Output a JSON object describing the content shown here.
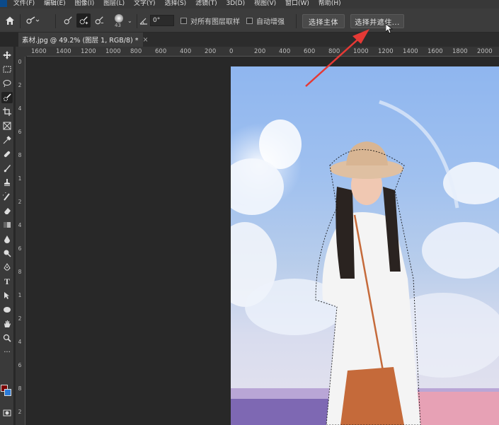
{
  "menubar": {
    "items": [
      "文件(F)",
      "编辑(E)",
      "图像(I)",
      "图层(L)",
      "文字(Y)",
      "选择(S)",
      "滤镜(T)",
      "3D(D)",
      "视图(V)",
      "窗口(W)",
      "帮助(H)"
    ]
  },
  "options": {
    "brush_size": "43",
    "angle_value": "0°",
    "sample_all_layers": "对所有图层取样",
    "auto_enhance": "自动增强",
    "select_subject": "选择主体",
    "select_and_mask": "选择并遮住..."
  },
  "document_tab": {
    "title": "素材.jpg @ 49.2% (图层 1, RGB/8) *",
    "close": "×"
  },
  "ruler": {
    "h_ticks": [
      "1600",
      "1400",
      "1200",
      "1000",
      "800",
      "600",
      "400",
      "200",
      "0",
      "200",
      "400",
      "600",
      "800",
      "1000",
      "1200",
      "1400",
      "1600",
      "1800",
      "2000"
    ],
    "v_ticks": [
      "0",
      "2",
      "4",
      "6",
      "8",
      "1",
      "2",
      "4",
      "6",
      "8",
      "1",
      "2",
      "4",
      "6",
      "8",
      "2"
    ]
  },
  "icons": {
    "home": "home-icon",
    "quick_select": "quick-selection-brush-icon",
    "tools": [
      "move-icon",
      "marquee-icon",
      "lasso-icon",
      "quick-select-icon",
      "crop-icon",
      "frame-icon",
      "eyedropper-icon",
      "healing-icon",
      "brush-icon",
      "stamp-icon",
      "history-brush-icon",
      "eraser-icon",
      "gradient-icon",
      "blur-icon",
      "dodge-icon",
      "pen-icon",
      "type-icon",
      "path-select-icon",
      "shape-icon",
      "hand-icon",
      "zoom-icon",
      "more-icon"
    ]
  },
  "colors": {
    "foreground": "#7b0000",
    "background": "#2c7bd8",
    "annotation_arrow": "#e53935"
  }
}
